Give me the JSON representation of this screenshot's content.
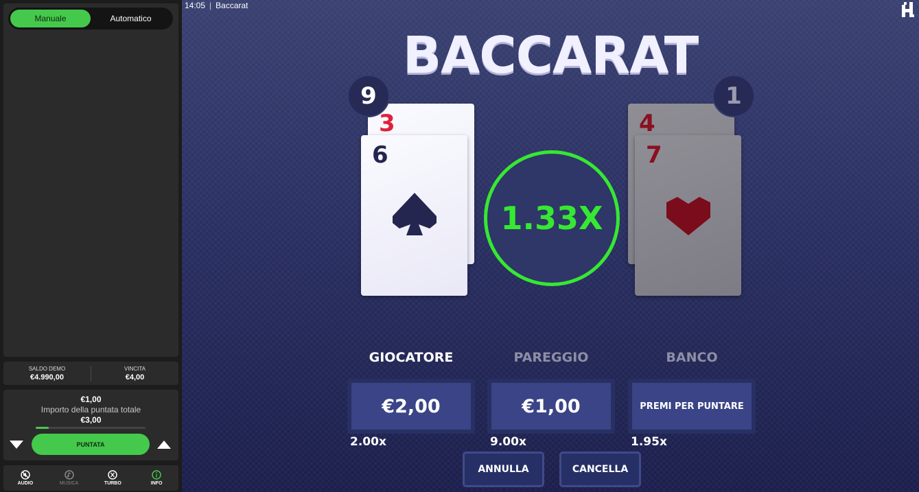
{
  "sidebar": {
    "mode_tabs": [
      {
        "label": "Manuale",
        "active": true
      },
      {
        "label": "Automatico",
        "active": false
      }
    ],
    "stats": {
      "balance_label": "SALDO DEMO",
      "balance_value": "€4.990,00",
      "win_label": "VINCITA",
      "win_value": "€4,00"
    },
    "bet": {
      "amount": "€1,00",
      "caption": "Importo della puntata totale",
      "total": "€3,00",
      "level_fraction": 0.12,
      "play_label": "PUNTATA",
      "decrease_icon": "triangle-down-icon",
      "increase_icon": "triangle-up-icon"
    },
    "toolbar": [
      {
        "label": "AUDIO",
        "icon": "sound-off-icon",
        "enabled": true
      },
      {
        "label": "MUSICA",
        "icon": "music-note-icon",
        "enabled": false
      },
      {
        "label": "TURBO",
        "icon": "turbo-icon",
        "enabled": true
      },
      {
        "label": "INFO",
        "icon": "info-icon",
        "enabled": true
      }
    ]
  },
  "header": {
    "time": "14:05",
    "app_title": "Baccarat",
    "brand_icon": "hacksaw-h-icon"
  },
  "game": {
    "title": "BACCARAT",
    "player_score": "9",
    "banker_score": "1",
    "player_cards": [
      {
        "rank": "3",
        "color": "#e0213b"
      },
      {
        "rank": "6",
        "color": "#24264f",
        "suit": "spade"
      }
    ],
    "banker_cards": [
      {
        "rank": "4",
        "color": "#8a1020"
      },
      {
        "rank": "7",
        "color": "#8a1020",
        "suit": "heart"
      }
    ],
    "multiplier": "1.33X",
    "multiplier_color": "#36e832",
    "bets": [
      {
        "title": "GIOCATORE",
        "value": "€2,00",
        "odds": "2.00x",
        "active": true
      },
      {
        "title": "PAREGGIO",
        "value": "€1,00",
        "odds": "9.00x",
        "active": false
      },
      {
        "title": "BANCO",
        "value": "PREMI PER PUNTARE",
        "odds": "1.95x",
        "active": false
      }
    ],
    "actions": {
      "undo_label": "ANNULLA",
      "clear_label": "CANCELLA"
    }
  },
  "colors": {
    "accent_green": "#45c94c",
    "panel": "#2b2b2b",
    "game_bg": "#2a3062"
  }
}
